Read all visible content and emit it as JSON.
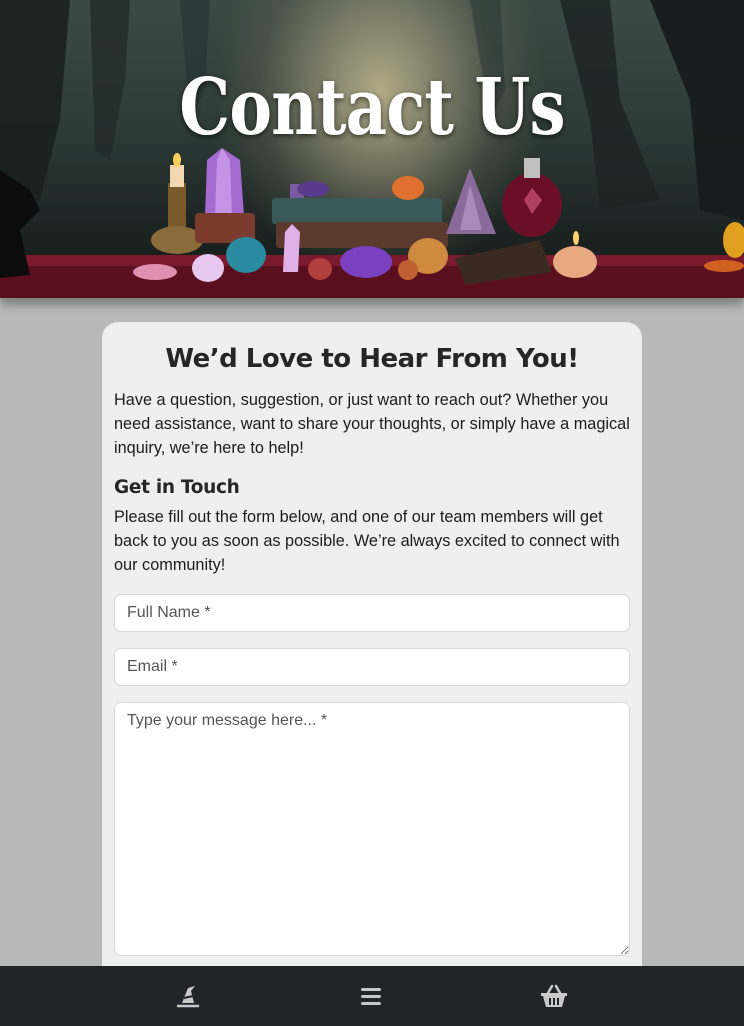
{
  "hero": {
    "title": "Contact Us"
  },
  "card": {
    "heading": "We’d Love to Hear From You!",
    "intro": "Have a question, suggestion, or just want to reach out? Whether you need assistance, want to share your thoughts, or simply have a magical inquiry, we’re here to help!",
    "subheading": "Get in Touch",
    "body": "Please fill out the form below, and one of our team members will get back to you as soon as possible. We’re always excited to connect with our community!"
  },
  "form": {
    "name_placeholder": "Full Name *",
    "email_placeholder": "Email *",
    "message_placeholder": "Type your message here... *"
  },
  "bottom_nav": {
    "items": [
      {
        "icon": "witch-hat-icon"
      },
      {
        "icon": "menu-icon"
      },
      {
        "icon": "basket-icon"
      }
    ]
  },
  "colors": {
    "background": "#b9b9b9",
    "card": "#efefef",
    "nav": "#212529",
    "nav_icon": "#c9c9c9"
  }
}
